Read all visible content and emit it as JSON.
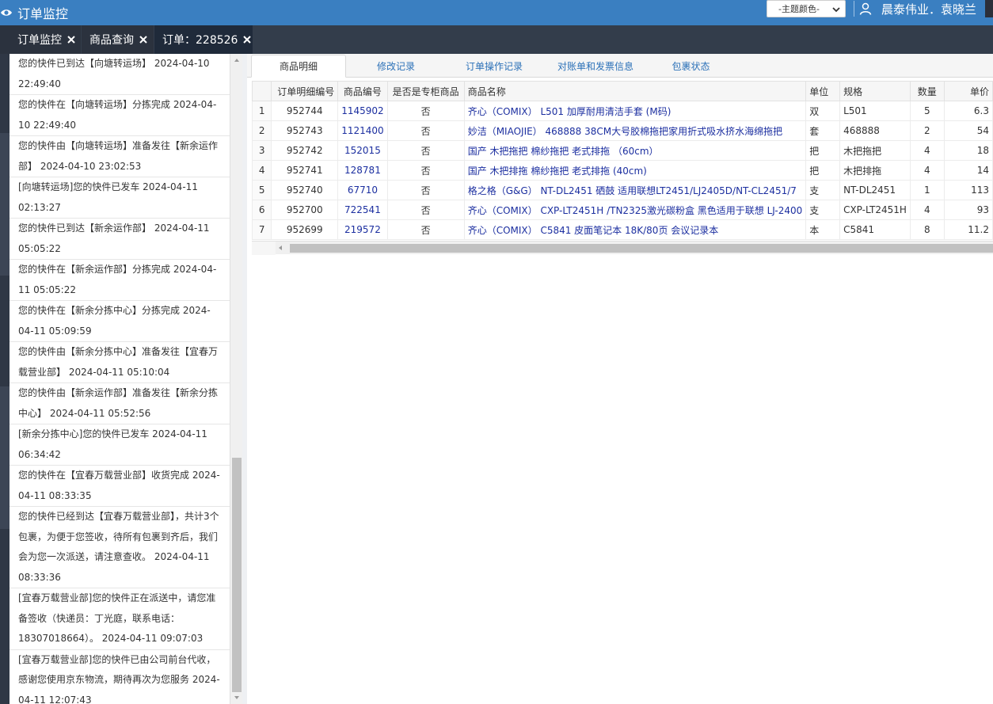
{
  "header": {
    "title": "订单监控",
    "theme_select_value": "-主题颜色-",
    "user_name": "晨泰伟业．袁晓兰",
    "colors": {
      "header_bg": "#3a7fc1",
      "tab_bg": "#333d4b"
    }
  },
  "tabs": [
    {
      "label": "订单监控"
    },
    {
      "label": "商品查询"
    },
    {
      "label": "订单：228526"
    }
  ],
  "tracking": [
    "您的快件已到达【向塘转运场】 2024-04-10 22:49:40",
    "您的快件在【向塘转运场】分拣完成 2024-04-10 22:49:40",
    "您的快件由【向塘转运场】准备发往【新余运作部】 2024-04-10 23:02:53",
    "[向塘转运场]您的快件已发车 2024-04-11 02:13:27",
    "您的快件已到达【新余运作部】 2024-04-11 05:05:22",
    "您的快件在【新余运作部】分拣完成 2024-04-11 05:05:22",
    "您的快件在【新余分拣中心】分拣完成 2024-04-11 05:09:59",
    "您的快件由【新余分拣中心】准备发往【宜春万载营业部】 2024-04-11 05:10:04",
    "您的快件由【新余运作部】准备发往【新余分拣中心】 2024-04-11 05:52:56",
    "[新余分拣中心]您的快件已发车 2024-04-11 06:34:42",
    "您的快件在【宜春万载营业部】收货完成 2024-04-11 08:33:35",
    "您的快件已经到达【宜春万载营业部】，共计3个包裹，为便于您签收，待所有包裹到齐后，我们会为您一次派送，请注意查收。 2024-04-11 08:33:36",
    "[宜春万载营业部]您的快件正在派送中，请您准备签收（快递员：丁光庭，联系电话：18307018664）。 2024-04-11 09:07:03",
    "[宜春万载营业部]您的快件已由公司前台代收，感谢您使用京东物流，期待再次为您服务 2024-04-11 12:07:43"
  ],
  "subtabs": [
    {
      "label": "商品明细",
      "active": true
    },
    {
      "label": "修改记录"
    },
    {
      "label": "订单操作记录"
    },
    {
      "label": "对账单和发票信息"
    },
    {
      "label": "包裹状态"
    }
  ],
  "table": {
    "columns": [
      "",
      "订单明细编号",
      "商品编号",
      "是否是专柜商品",
      "商品名称",
      "单位",
      "规格",
      "数量",
      "单价"
    ],
    "rows": [
      [
        "1",
        "952744",
        "1145902",
        "否",
        "齐心（COMIX） L501 加厚耐用清洁手套 (M码)",
        "双",
        "L501",
        "5",
        "6.3"
      ],
      [
        "2",
        "952743",
        "1121400",
        "否",
        "妙洁（MIAOJIE） 468888 38CM大号胶棉拖把家用折式吸水挤水海绵拖把",
        "套",
        "468888",
        "2",
        "54"
      ],
      [
        "3",
        "952742",
        "152015",
        "否",
        "国产 木把拖把 棉纱拖把 老式排拖 （60cm）",
        "把",
        "木把拖把",
        "4",
        "18"
      ],
      [
        "4",
        "952741",
        "128781",
        "否",
        "国产 木把排拖 棉纱拖把 老式排拖 (40cm)",
        "把",
        "木把排拖",
        "4",
        "14"
      ],
      [
        "5",
        "952740",
        "67710",
        "否",
        "格之格（G&G） NT-DL2451 硒鼓 适用联想LT2451/LJ2405D/NT-CL2451/7",
        "支",
        "NT-DL2451",
        "1",
        "113"
      ],
      [
        "6",
        "952700",
        "722541",
        "否",
        "齐心（COMIX） CXP-LT2451H /TN2325激光碳粉盒 黑色适用于联想 LJ-2400",
        "支",
        "CXP-LT2451H",
        "4",
        "93"
      ],
      [
        "7",
        "952699",
        "219572",
        "否",
        "齐心（COMIX） C5841 皮面笔记本 18K/80页 会议记录本",
        "本",
        "C5841",
        "8",
        "11.2"
      ]
    ]
  }
}
